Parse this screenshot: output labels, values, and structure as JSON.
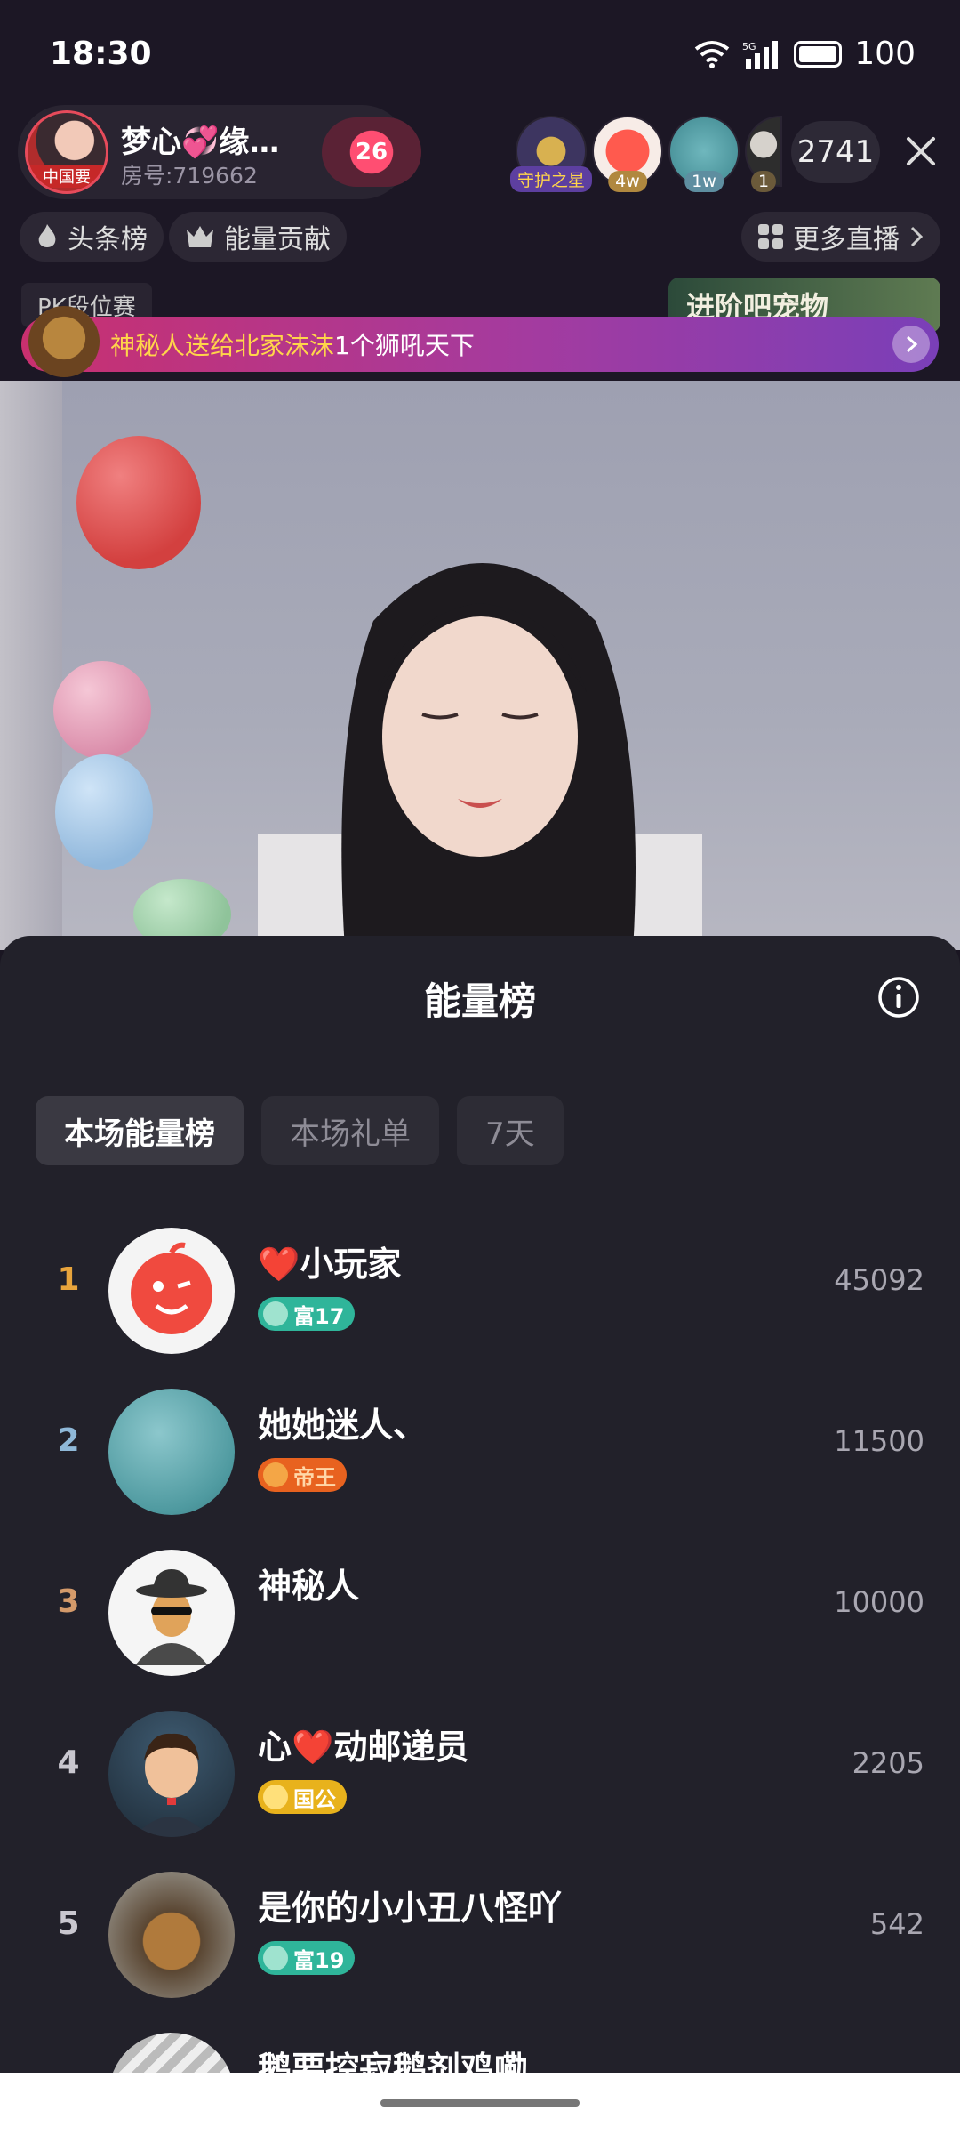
{
  "status": {
    "time": "18:30",
    "network": "5G",
    "battery": "100"
  },
  "host": {
    "name": "梦心💞缘…",
    "room": "房号:719662",
    "avatar_tag": "中国要",
    "badge": "26"
  },
  "audience": {
    "items": [
      {
        "tag": "守护之星",
        "color": "#d8b150"
      },
      {
        "tag": "4w",
        "color": "#e74c3c"
      },
      {
        "tag": "1w",
        "color": "#5aa5ad"
      },
      {
        "tag": "1",
        "color": "#3b3b3b"
      }
    ],
    "count": "2741"
  },
  "row2": {
    "headline": "头条榜",
    "contribution": "能量贡献",
    "more_live": "更多直播"
  },
  "pk_label": "PK段位赛",
  "pet_banner": "进阶吧宠物",
  "gift_banner": {
    "sender": "神秘人",
    "verb": " 送给 ",
    "receiver": "北家沫沫",
    "gift": " 1个狮吼天下"
  },
  "sheet": {
    "title": "能量榜",
    "tabs": [
      "本场能量榜",
      "本场礼单",
      "7天"
    ],
    "active_tab": 0,
    "ranks": [
      {
        "rank": "1",
        "name": "❤️小玩家",
        "badge": "富17",
        "badge_type": "rich",
        "score": "45092",
        "num_color": "#e8a43c"
      },
      {
        "rank": "2",
        "name": "她她迷人、",
        "badge": "帝王",
        "badge_type": "emperor",
        "score": "11500",
        "num_color": "#8fb8d8"
      },
      {
        "rank": "3",
        "name": "神秘人",
        "badge": "",
        "badge_type": "none",
        "score": "10000",
        "num_color": "#d49a6a"
      },
      {
        "rank": "4",
        "name": "心❤️动邮递员",
        "badge": "国公",
        "badge_type": "duke",
        "score": "2205",
        "num_color": "#c9c7cf"
      },
      {
        "rank": "5",
        "name": "是你的小小丑八怪吖",
        "badge": "富19",
        "badge_type": "rich",
        "score": "542",
        "num_color": "#c9c7cf"
      },
      {
        "rank": "",
        "name": "鹅要控寂鹅剂鸡嘞",
        "badge": "",
        "badge_type": "none",
        "score": "",
        "num_color": "#c9c7cf"
      }
    ]
  },
  "colors": {
    "accent_gold": "#ffd54a",
    "sheet_bg": "#22212a",
    "rich_badge": "#2fb59a",
    "emperor_badge": "#e8621f",
    "duke_badge": "#e8b21c"
  }
}
